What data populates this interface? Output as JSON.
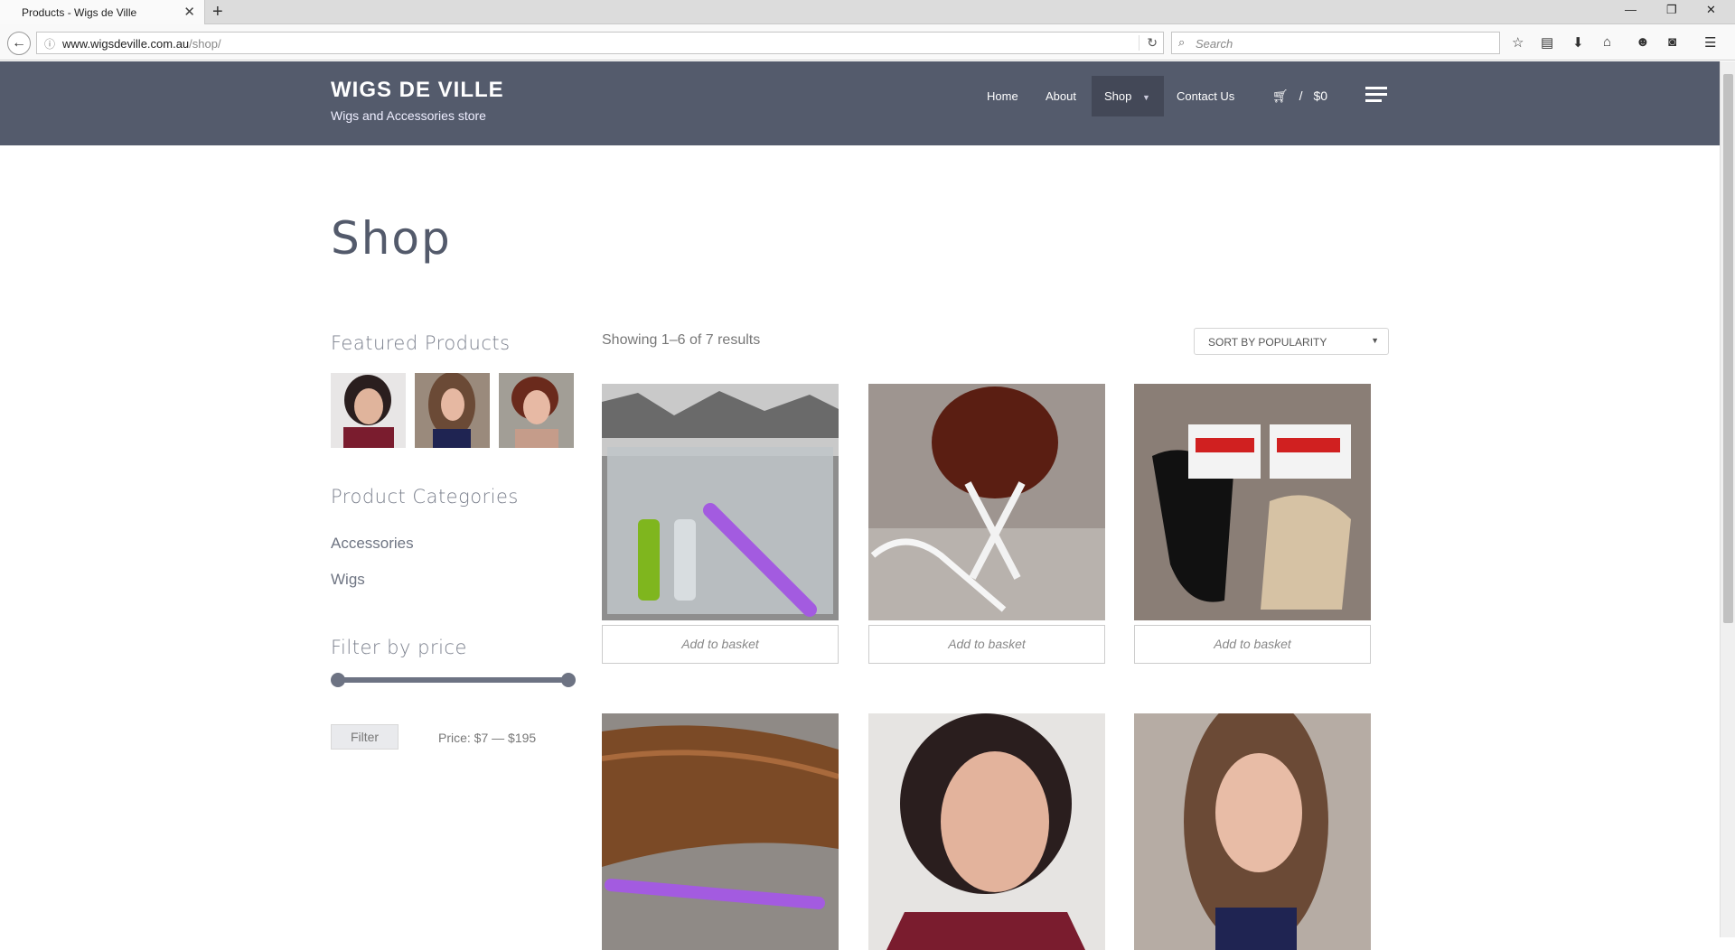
{
  "browser": {
    "tab_title": "Products - Wigs de Ville",
    "url_host": "www.wigsdeville.com.au",
    "url_path": "/shop/",
    "search_placeholder": "Search"
  },
  "site": {
    "title": "WIGS DE VILLE",
    "tagline": "Wigs and Accessories store",
    "nav": {
      "home": "Home",
      "about": "About",
      "shop": "Shop",
      "contact": "Contact Us"
    },
    "cart_total": "$0"
  },
  "page": {
    "title": "Shop"
  },
  "sidebar": {
    "featured_title": "Featured Products",
    "categories_title": "Product Categories",
    "categories": [
      "Accessories",
      "Wigs"
    ],
    "filter_title": "Filter by price",
    "filter_button": "Filter",
    "price_label": "Price: $7 — $195",
    "price_range": {
      "min": 7,
      "max": 195,
      "selected_min_pct": 0,
      "selected_max_pct": 100
    }
  },
  "shop": {
    "results_text": "Showing 1–6 of 7 results",
    "sort_label": "SORT BY POPULARITY",
    "add_to_basket": "Add to basket"
  },
  "colors": {
    "header_bg": "#545b6c",
    "accent": "#6d7383"
  }
}
